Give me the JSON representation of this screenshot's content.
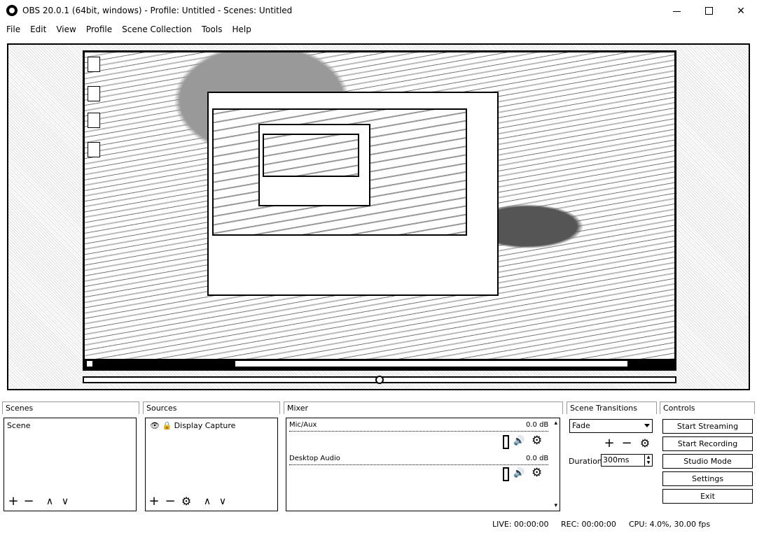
{
  "window": {
    "title": "OBS 20.0.1 (64bit, windows) - Profile: Untitled - Scenes: Untitled"
  },
  "menu": [
    "File",
    "Edit",
    "View",
    "Profile",
    "Scene Collection",
    "Tools",
    "Help"
  ],
  "docks": {
    "scenes": {
      "title": "Scenes",
      "items": [
        "Scene"
      ]
    },
    "sources": {
      "title": "Sources",
      "items": [
        {
          "label": "Display Capture",
          "visible_icon": "eye-icon",
          "lock_icon": "lock-icon"
        }
      ]
    },
    "mixer": {
      "title": "Mixer",
      "channels": [
        {
          "name": "Mic/Aux",
          "db": "0.0 dB"
        },
        {
          "name": "Desktop Audio",
          "db": "0.0 dB"
        }
      ]
    },
    "transitions": {
      "title": "Scene Transitions",
      "selected": "Fade",
      "duration_label": "Duration",
      "duration_value": "300ms"
    },
    "controls": {
      "title": "Controls",
      "buttons": [
        "Start Streaming",
        "Start Recording",
        "Studio Mode",
        "Settings",
        "Exit"
      ]
    }
  },
  "status": {
    "live": "LIVE: 00:00:00",
    "rec": "REC: 00:00:00",
    "cpu": "CPU: 4.0%, 30.00 fps"
  },
  "icons": {
    "add": "+",
    "remove": "−",
    "up": "∧",
    "down": "∨",
    "gear": "⚙",
    "speaker": "🔊"
  }
}
